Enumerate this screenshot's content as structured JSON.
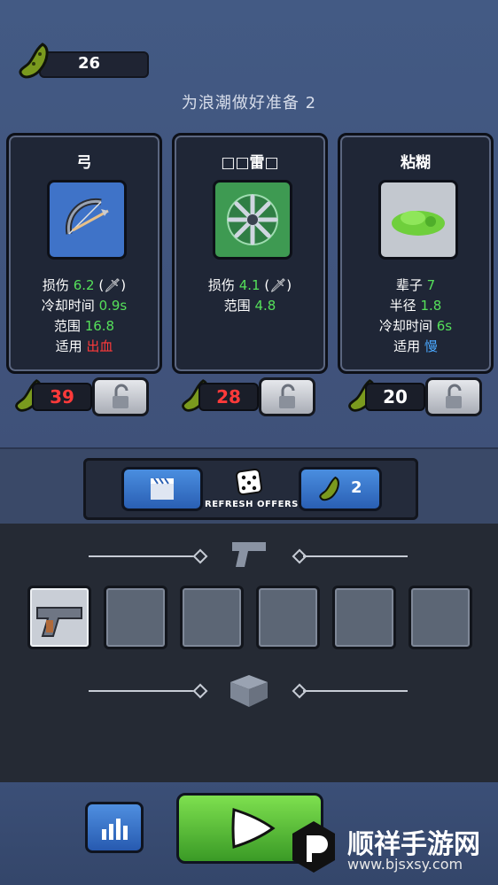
{
  "currency": {
    "amount": "26"
  },
  "wave_title": "为浪潮做好准备 2",
  "cards": [
    {
      "title": "弓",
      "stats": [
        {
          "label": "损伤",
          "value": "6.2",
          "extra": "(🗡)"
        },
        {
          "label": "冷却时间",
          "value": "0.9s"
        },
        {
          "label": "范围",
          "value": "16.8"
        },
        {
          "label": "适用",
          "value": "出血"
        }
      ],
      "price": "39"
    },
    {
      "title": "□□雷□",
      "stats": [
        {
          "label": "损伤",
          "value": "4.1",
          "extra": "(🗡)"
        },
        {
          "label": "范围",
          "value": "4.8"
        }
      ],
      "price": "28"
    },
    {
      "title": "粘糊",
      "stats": [
        {
          "label": "辈子",
          "value": "7"
        },
        {
          "label": "半径",
          "value": "1.8"
        },
        {
          "label": "冷却时间",
          "value": "6s"
        },
        {
          "label": "适用",
          "value": "慢"
        }
      ],
      "price": "20"
    }
  ],
  "refresh": {
    "label": "REFRESH OFFERS",
    "cost": "2"
  },
  "watermark": {
    "name": "顺祥手游网",
    "url": "www.bjsxsy.com"
  },
  "icons": {
    "currency": "pickle-icon",
    "lock": "unlock-icon",
    "video": "clapperboard-icon",
    "dice": "dice-icon",
    "gun": "pistol-icon",
    "box": "box-icon",
    "stats": "bar-chart-icon",
    "play": "play-icon"
  },
  "colors": {
    "green": "#55e05a",
    "red": "#ff3a3a",
    "blue": "#4aa8ff"
  }
}
